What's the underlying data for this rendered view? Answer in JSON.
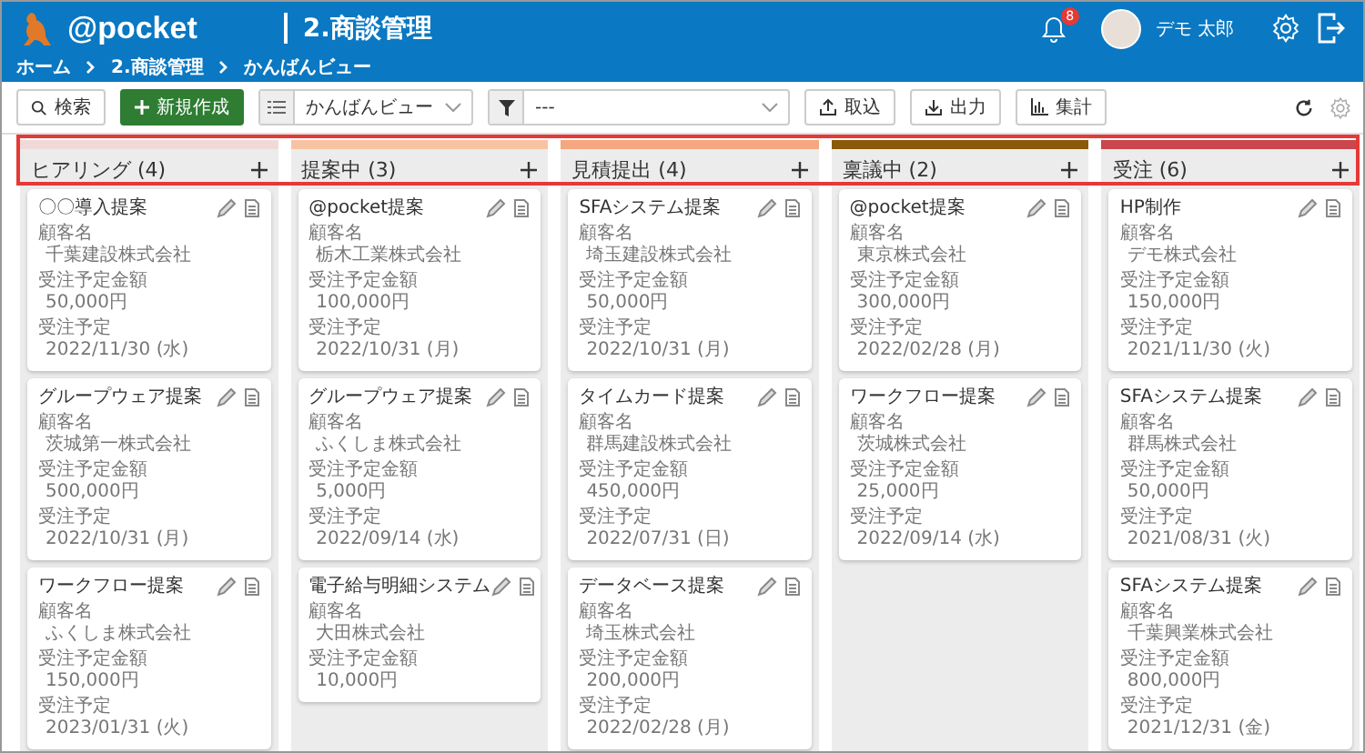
{
  "header": {
    "logo": "@pocket",
    "title": "2.商談管理",
    "notifications": "8",
    "user": "デモ 太郎"
  },
  "breadcrumb": [
    "ホーム",
    "2.商談管理",
    "かんばんビュー"
  ],
  "toolbar": {
    "search": "検索",
    "create": "新規作成",
    "view_select": "かんばんビュー",
    "filter_select": "---",
    "import": "取込",
    "export": "出力",
    "summary": "集計"
  },
  "columns": [
    {
      "title": "ヒアリング (4)",
      "color": "#f2d9d9",
      "cards": [
        {
          "title": "〇〇導入提案",
          "fields": [
            {
              "label": "顧客名",
              "value": "千葉建設株式会社"
            },
            {
              "label": "受注予定金額",
              "value": "50,000円"
            },
            {
              "label": "受注予定",
              "value": "2022/11/30 (水)"
            }
          ]
        },
        {
          "title": "グループウェア提案",
          "fields": [
            {
              "label": "顧客名",
              "value": "茨城第一株式会社"
            },
            {
              "label": "受注予定金額",
              "value": "500,000円"
            },
            {
              "label": "受注予定",
              "value": "2022/10/31 (月)"
            }
          ]
        },
        {
          "title": "ワークフロー提案",
          "fields": [
            {
              "label": "顧客名",
              "value": "ふくしま株式会社"
            },
            {
              "label": "受注予定金額",
              "value": "150,000円"
            },
            {
              "label": "受注予定",
              "value": "2023/01/31 (火)"
            }
          ]
        }
      ]
    },
    {
      "title": "提案中 (3)",
      "color": "#f8c3a3",
      "cards": [
        {
          "title": "@pocket提案",
          "fields": [
            {
              "label": "顧客名",
              "value": "栃木工業株式会社"
            },
            {
              "label": "受注予定金額",
              "value": "100,000円"
            },
            {
              "label": "受注予定",
              "value": "2022/10/31 (月)"
            }
          ]
        },
        {
          "title": "グループウェア提案",
          "fields": [
            {
              "label": "顧客名",
              "value": "ふくしま株式会社"
            },
            {
              "label": "受注予定金額",
              "value": "5,000円"
            },
            {
              "label": "受注予定",
              "value": "2022/09/14 (水)"
            }
          ]
        },
        {
          "title": "電子給与明細システム",
          "fields": [
            {
              "label": "顧客名",
              "value": "大田株式会社"
            },
            {
              "label": "受注予定金額",
              "value": "10,000円"
            }
          ]
        }
      ]
    },
    {
      "title": "見積提出 (4)",
      "color": "#f5a77f",
      "cards": [
        {
          "title": "SFAシステム提案",
          "fields": [
            {
              "label": "顧客名",
              "value": "埼玉建設株式会社"
            },
            {
              "label": "受注予定金額",
              "value": "50,000円"
            },
            {
              "label": "受注予定",
              "value": "2022/10/31 (月)"
            }
          ]
        },
        {
          "title": "タイムカード提案",
          "fields": [
            {
              "label": "顧客名",
              "value": "群馬建設株式会社"
            },
            {
              "label": "受注予定金額",
              "value": "450,000円"
            },
            {
              "label": "受注予定",
              "value": "2022/07/31 (日)"
            }
          ]
        },
        {
          "title": "データベース提案",
          "fields": [
            {
              "label": "顧客名",
              "value": "埼玉株式会社"
            },
            {
              "label": "受注予定金額",
              "value": "200,000円"
            },
            {
              "label": "受注予定",
              "value": "2022/02/28 (月)"
            }
          ]
        }
      ]
    },
    {
      "title": "稟議中 (2)",
      "color": "#8a5a0a",
      "cards": [
        {
          "title": "@pocket提案",
          "fields": [
            {
              "label": "顧客名",
              "value": "東京株式会社"
            },
            {
              "label": "受注予定金額",
              "value": "300,000円"
            },
            {
              "label": "受注予定",
              "value": "2022/02/28 (月)"
            }
          ]
        },
        {
          "title": "ワークフロー提案",
          "fields": [
            {
              "label": "顧客名",
              "value": "茨城株式会社"
            },
            {
              "label": "受注予定金額",
              "value": "25,000円"
            },
            {
              "label": "受注予定",
              "value": "2022/09/14 (水)"
            }
          ]
        }
      ]
    },
    {
      "title": "受注 (6)",
      "color": "#c9474d",
      "cards": [
        {
          "title": "HP制作",
          "fields": [
            {
              "label": "顧客名",
              "value": "デモ株式会社"
            },
            {
              "label": "受注予定金額",
              "value": "150,000円"
            },
            {
              "label": "受注予定",
              "value": "2021/11/30 (火)"
            }
          ]
        },
        {
          "title": "SFAシステム提案",
          "fields": [
            {
              "label": "顧客名",
              "value": "群馬株式会社"
            },
            {
              "label": "受注予定金額",
              "value": "50,000円"
            },
            {
              "label": "受注予定",
              "value": "2021/08/31 (火)"
            }
          ]
        },
        {
          "title": "SFAシステム提案",
          "fields": [
            {
              "label": "顧客名",
              "value": "千葉興業株式会社"
            },
            {
              "label": "受注予定金額",
              "value": "800,000円"
            },
            {
              "label": "受注予定",
              "value": "2021/12/31 (金)"
            }
          ]
        }
      ]
    }
  ]
}
